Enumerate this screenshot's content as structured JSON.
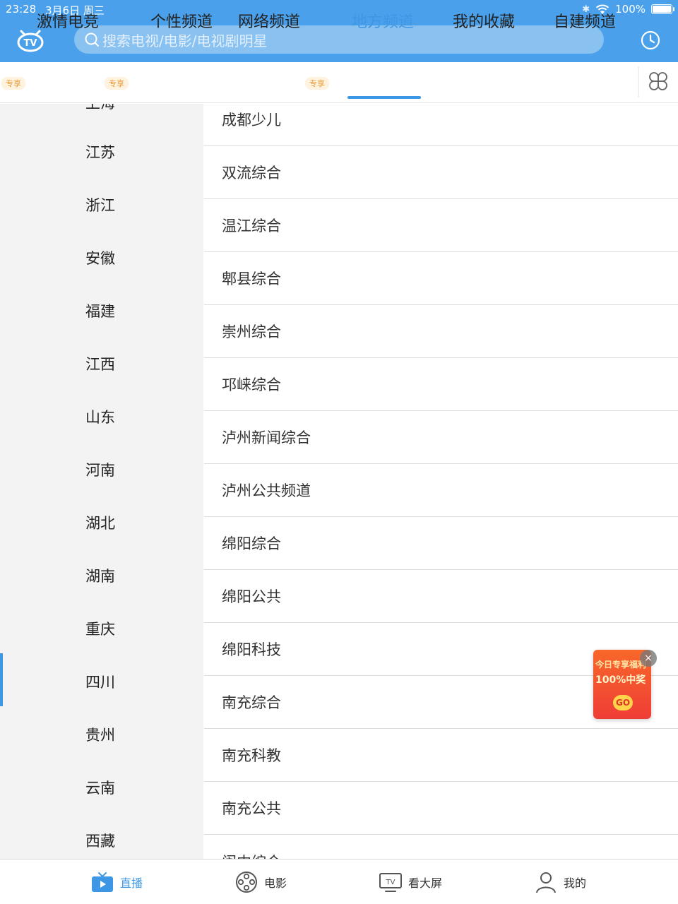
{
  "status_bar": {
    "time": "23:28",
    "date": "3月6日 周三",
    "battery": "100%",
    "battery_level": 1.0
  },
  "header": {
    "logo_icon": "tv-cat-logo-icon",
    "search_placeholder": "搜索电视/电影/电视剧明星",
    "history_icon": "clock-icon"
  },
  "tabs": [
    {
      "label": "激情电竞",
      "badge": "专享",
      "active": false
    },
    {
      "label": "个性频道",
      "active": false
    },
    {
      "label": "网络频道",
      "badge": "专享",
      "active": false
    },
    {
      "label": "地方频道",
      "active": true
    },
    {
      "label": "我的收藏",
      "active": false
    },
    {
      "label": "自建频道",
      "active": false
    }
  ],
  "tab_left_badge": "专享",
  "provinces": [
    "上海",
    "江苏",
    "浙江",
    "安徽",
    "福建",
    "江西",
    "山东",
    "河南",
    "湖北",
    "湖南",
    "重庆",
    "四川",
    "贵州",
    "云南",
    "西藏"
  ],
  "selected_province": "四川",
  "channels": [
    "成都少儿",
    "双流综合",
    "温江综合",
    "郫县综合",
    "崇州综合",
    "邛崃综合",
    "泸州新闻综合",
    "泸州公共频道",
    "绵阳综合",
    "绵阳公共",
    "绵阳科技",
    "南充综合",
    "南充科教",
    "南充公共",
    "阆中综合"
  ],
  "promo": {
    "line1": "今日专享福利",
    "line2": "100%中奖",
    "go": "GO",
    "close": "×"
  },
  "bottom_nav": [
    {
      "label": "直播",
      "icon": "live-tv-icon",
      "active": true
    },
    {
      "label": "电影",
      "icon": "film-reel-icon",
      "active": false
    },
    {
      "label": "看大屏",
      "icon": "big-screen-tv-icon",
      "active": false
    },
    {
      "label": "我的",
      "icon": "user-icon",
      "active": false
    }
  ],
  "colors": {
    "brand_blue": "#4aa0ea",
    "active_blue": "#3e97e5",
    "badge_orange": "#e79a36"
  }
}
